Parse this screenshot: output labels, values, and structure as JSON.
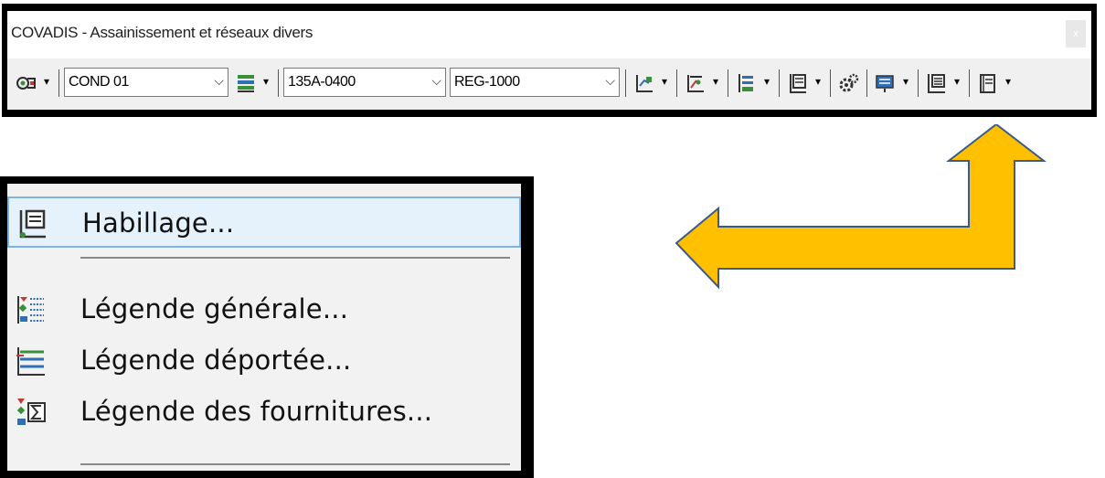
{
  "window": {
    "title": "COVADIS - Assainissement et réseaux divers",
    "close_label": "x"
  },
  "toolbar": {
    "combo_1": "COND 01",
    "combo_2": "135A-0400",
    "combo_3": "REG-1000",
    "dropdown_arrow": "▾",
    "combo_arrow": "⌵",
    "icons": [
      "network-icon",
      "layer-icon",
      "profile-icon",
      "section-icon",
      "branch-icon",
      "sheet-icon",
      "settings-gear-icon",
      "display-icon",
      "habillage-icon",
      "document-icon"
    ]
  },
  "menu": {
    "items": [
      {
        "label": "Habillage...",
        "icon": "habillage-icon"
      },
      {
        "label": "Légende générale...",
        "icon": "legend-general-icon"
      },
      {
        "label": "Légende déportée...",
        "icon": "legend-offset-icon"
      },
      {
        "label": "Légende des fournitures...",
        "icon": "legend-supplies-icon"
      }
    ]
  },
  "colors": {
    "arrow_fill": "#ffc000",
    "arrow_stroke": "#3a5a8c",
    "highlight_bg": "#e5f1fb",
    "highlight_border": "#7fb4e0"
  }
}
